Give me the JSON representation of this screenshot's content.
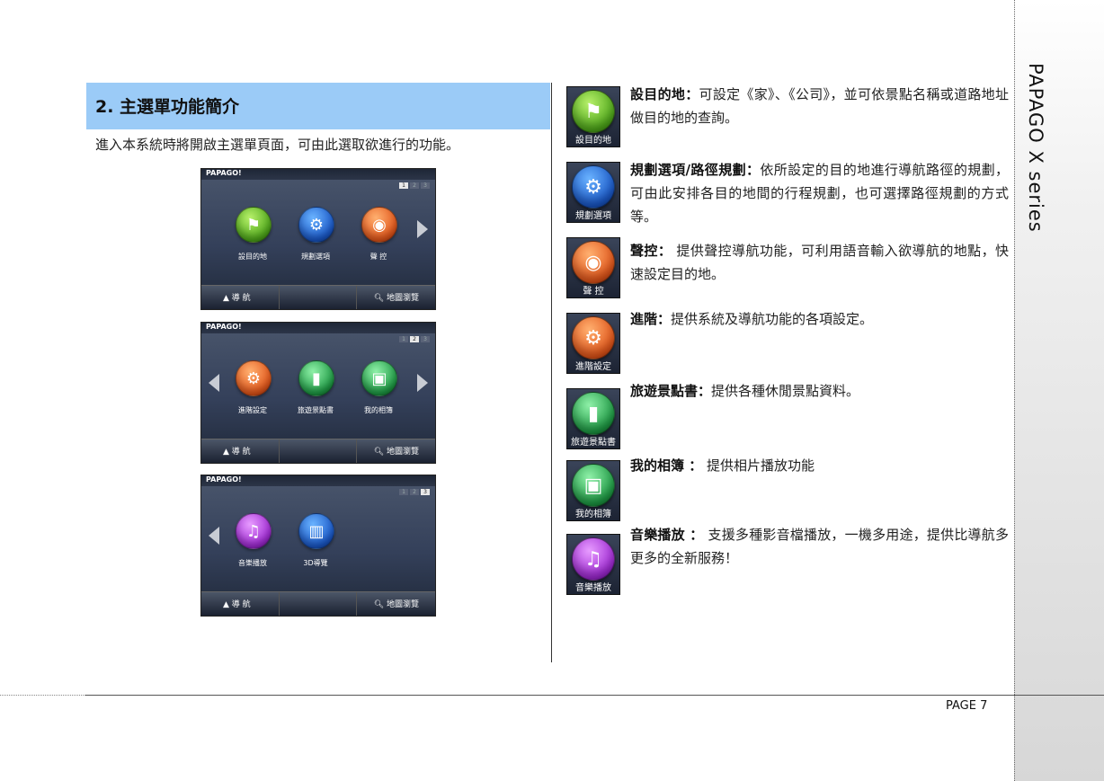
{
  "sidebar": {
    "title": "PAPAGO X series"
  },
  "footer": {
    "page": "PAGE  7"
  },
  "section": {
    "title": "2.  主選單功能簡介",
    "intro": "進入本系統時將開啟主選單頁面，可由此選取欲進行的功能。"
  },
  "screens": [
    {
      "brand": "PAPAGO!",
      "pages": [
        "1",
        "2",
        "3"
      ],
      "active_page": 1,
      "items": [
        "設目的地",
        "規劃選項",
        "聲 控"
      ],
      "nav": "導 航",
      "map": "地圖瀏覽"
    },
    {
      "brand": "PAPAGO!",
      "pages": [
        "1",
        "2",
        "3"
      ],
      "active_page": 2,
      "items": [
        "進階設定",
        "旅遊景點書",
        "我的相簿"
      ],
      "nav": "導 航",
      "map": "地圖瀏覽"
    },
    {
      "brand": "PAPAGO!",
      "pages": [
        "1",
        "2",
        "3"
      ],
      "active_page": 3,
      "items": [
        "音樂播放",
        "3D導覽"
      ],
      "nav": "導 航",
      "map": "地圖瀏覽"
    }
  ],
  "features": [
    {
      "icon_caption": "設目的地",
      "icon": "checkered-flag-icon",
      "color": "#4ea71a",
      "term": "設目的地：",
      "desc": "可設定《家》、《公司》，並可依景點名稱或道路地址做目的地的查詢。"
    },
    {
      "icon_caption": "規劃選項",
      "icon": "gear-document-icon",
      "color": "#1a58c8",
      "term": "規劃選項/路徑規劃：",
      "desc": "依所設定的目的地進行導航路徑的規劃，可由此安排各目的地間的行程規劃，也可選擇路徑規劃的方式等。"
    },
    {
      "icon_caption": "聲 控",
      "icon": "voice-control-icon",
      "color": "#e2561a",
      "term": "聲控：",
      "desc": " 提供聲控導航功能，可利用語音輸入欲導航的地點，快速設定目的地。"
    },
    {
      "icon_caption": "進階設定",
      "icon": "gear-icon",
      "color": "#e2561a",
      "term": "進階：",
      "desc": "提供系統及導航功能的各項設定。"
    },
    {
      "icon_caption": "旅遊景點書",
      "icon": "book-icon",
      "color": "#2bb04a",
      "term": "旅遊景點書：",
      "desc": "提供各種休閒景點資料。"
    },
    {
      "icon_caption": "我的相簿",
      "icon": "photo-album-icon",
      "color": "#2bb04a",
      "term": "我的相簿 ：",
      "desc": " 提供相片播放功能"
    },
    {
      "icon_caption": "音樂播放",
      "icon": "music-note-icon",
      "color": "#a02ad4",
      "term": "音樂播放 ：",
      "desc": " 支援多種影音檔播放，一機多用途，提供比導航多更多的全新服務！"
    }
  ]
}
